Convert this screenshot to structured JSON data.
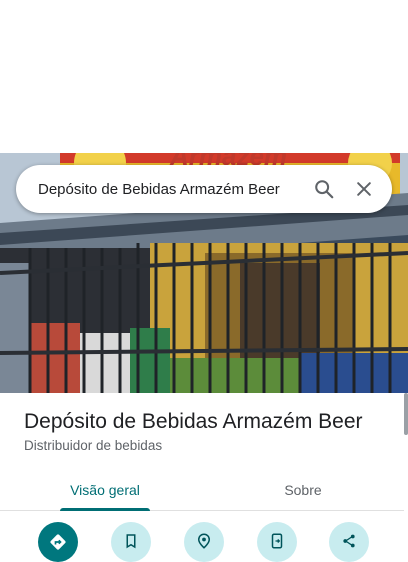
{
  "search": {
    "value": "Depósito de Bebidas Armazém Beer",
    "search_icon": "search-icon",
    "clear_icon": "close-icon"
  },
  "hero": {
    "sign_text": "Armazém"
  },
  "place": {
    "name": "Depósito de Bebidas Armazém Beer",
    "category": "Distribuidor de bebidas"
  },
  "tabs": [
    {
      "label": "Visão geral",
      "active": true
    },
    {
      "label": "Sobre",
      "active": false
    }
  ],
  "actions": [
    {
      "icon": "directions-icon"
    },
    {
      "icon": "save-icon"
    },
    {
      "icon": "nearby-icon"
    },
    {
      "icon": "send-to-phone-icon"
    },
    {
      "icon": "share-icon"
    }
  ],
  "colors": {
    "accent": "#006e74",
    "action_primary": "#00777e",
    "action_secondary": "#c8ecef"
  }
}
